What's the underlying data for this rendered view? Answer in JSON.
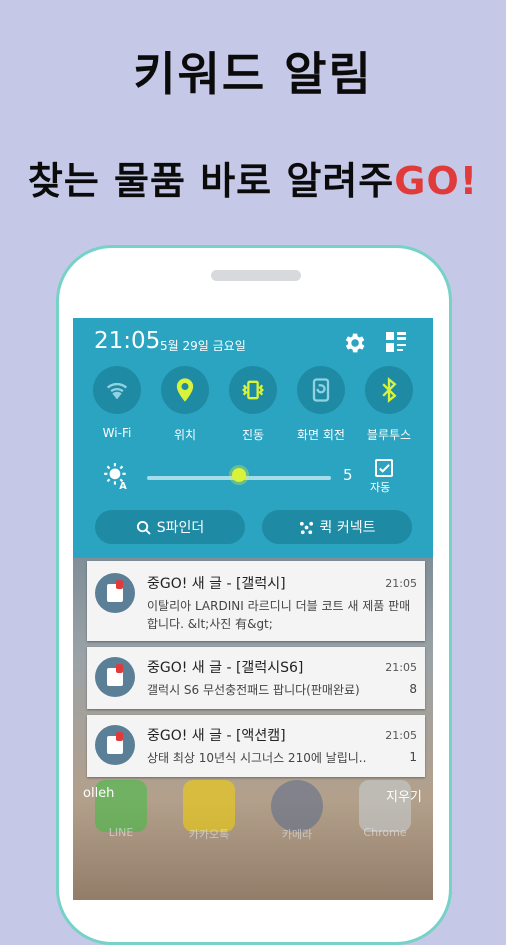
{
  "promo": {
    "line1": "키워드 알림",
    "line2_main": "찾는 물품 바로 알려주",
    "line2_accent": "GO!"
  },
  "status": {
    "time": "21:05",
    "date": "5월 29일 금요일"
  },
  "toggles": [
    {
      "label": "Wi-Fi",
      "icon": "wifi-icon"
    },
    {
      "label": "위치",
      "icon": "location-icon"
    },
    {
      "label": "진동",
      "icon": "vibrate-icon"
    },
    {
      "label": "화면 회전",
      "icon": "rotate-icon"
    },
    {
      "label": "블루투스",
      "icon": "bluetooth-icon"
    }
  ],
  "brightness": {
    "value": "5",
    "auto_label": "자동",
    "level": 0.5
  },
  "quick_buttons": {
    "s_finder": "S파인더",
    "quick_connect": "퀵 커넥트"
  },
  "notifications": [
    {
      "title": "중GO! 새 글 - [갤럭시]",
      "time": "21:05",
      "body": "이탈리아 LARDINI 라르디니 더블 코트 새 제품 판매합니다. &lt;사진 有&gt;",
      "count": ""
    },
    {
      "title": "중GO! 새 글 - [갤럭시S6]",
      "time": "21:05",
      "body": "갤럭시 S6 무선충전패드 팝니다(판매완료)",
      "count": "8"
    },
    {
      "title": "중GO! 새 글 - [액션캠]",
      "time": "21:05",
      "body": "상태 최상 10년식 시그너스 210에 날립니..",
      "count": "1"
    }
  ],
  "footer": {
    "carrier": "olleh",
    "clear": "지우기"
  },
  "home_apps": [
    {
      "label": "LINE"
    },
    {
      "label": "카카오톡"
    },
    {
      "label": "카메라"
    },
    {
      "label": "Chrome"
    }
  ],
  "colors": {
    "panel": "#2ba4c1",
    "accent": "#e03a3a",
    "background": "#c5c9e7"
  }
}
